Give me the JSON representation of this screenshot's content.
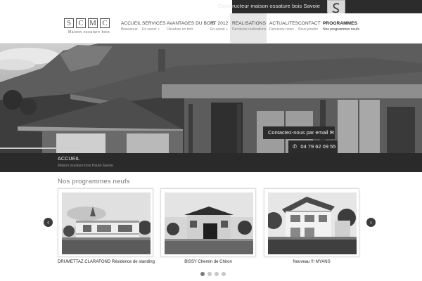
{
  "topbar": {
    "tagline": "Constructeur maison ossature bois Savoie"
  },
  "logo": {
    "letters": [
      "S",
      "C",
      "M",
      "C"
    ],
    "tagline": "Maison ossature bois"
  },
  "nav": [
    {
      "label": "ACCUEIL",
      "sub": "Bienvenue",
      "active": false
    },
    {
      "label": "SERVICES",
      "sub": "En savoir +",
      "active": false
    },
    {
      "label": "AVANTAGES DU BOIS",
      "sub": "Ossature en bois",
      "active": false
    },
    {
      "label": "RT 2012",
      "sub": "En savoir +",
      "active": false
    },
    {
      "label": "REALISATIONS",
      "sub": "Dernieres realisations",
      "active": true
    },
    {
      "label": "ACTUALITES",
      "sub": "Dernieres news",
      "active": false
    },
    {
      "label": "CONTACT",
      "sub": "Nous joindre",
      "active": false
    },
    {
      "label": "PROGRAMMES",
      "sub": "Nos programmes neufs",
      "active": false
    }
  ],
  "hero": {
    "email_cta": "Contactez-nous par email",
    "phone_cta": "04 79 62 09 55"
  },
  "breadcrumb": {
    "title": "ACCUEIL",
    "subtitle": "Maison ossature bois Haute-Savoie"
  },
  "section": {
    "title": "Nos programmes neufs"
  },
  "programs": [
    {
      "caption": "DRUMETTAZ CLARAFOND Résidence de standing"
    },
    {
      "caption": "BISSY Chemin de Chiron"
    },
    {
      "caption": "Nouveau !!! MYANS"
    }
  ],
  "carousel": {
    "dots": 4,
    "active_index": 0
  },
  "colors": {
    "dark_bar": "#2c2c2c",
    "active_nav": "#e6e6e6",
    "accent_text": "#777777"
  },
  "icons": {
    "prev": "chevron-left-icon",
    "next": "chevron-right-icon",
    "email": "envelope-icon",
    "phone": "phone-icon"
  }
}
